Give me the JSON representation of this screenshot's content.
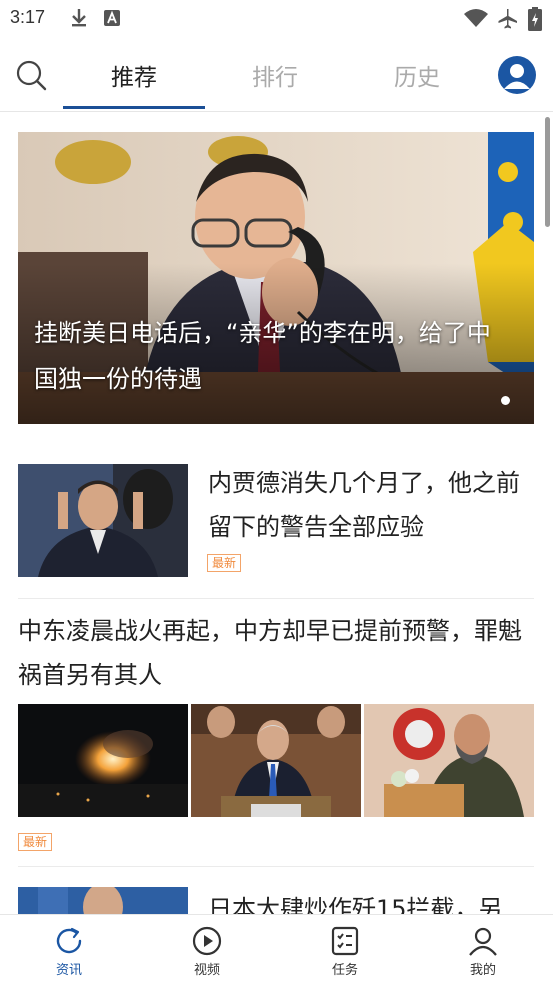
{
  "status_bar": {
    "time": "3:17",
    "icons": [
      "download-icon",
      "text-a-icon",
      "wifi-icon",
      "airplane-mode-icon",
      "battery-charging-icon"
    ]
  },
  "top_bar": {
    "tabs": [
      {
        "label": "推荐",
        "active": true
      },
      {
        "label": "排行",
        "active": false
      },
      {
        "label": "历史",
        "active": false
      }
    ],
    "icons": [
      "search-icon",
      "profile-icon"
    ],
    "accent_color": "#1b4f96"
  },
  "feed": {
    "hero": {
      "title": "挂断美日电话后，“亲华”的李在明，给了中国独一份的待遇",
      "image": "man-on-phone-photo",
      "carousel_position": 1
    },
    "items": [
      {
        "title": "内贾德消失几个月了，他之前留下的警告全部应验",
        "badge": "最新",
        "image": "man-waving-photo"
      },
      {
        "title": "中东凌晨战火再起，中方却早已提前预警，罪魁祸首另有其人",
        "badge": "最新",
        "images": [
          "night-explosion-photo",
          "man-at-podium-photo",
          "military-officer-speaking-photo"
        ]
      },
      {
        "title": "日本大肆炒作歼15拦截，另"
      }
    ],
    "badge_color": "#f08a3c"
  },
  "bottom_nav": {
    "items": [
      {
        "label": "资讯",
        "icon": "refresh-icon",
        "active": true
      },
      {
        "label": "视频",
        "icon": "play-icon",
        "active": false
      },
      {
        "label": "任务",
        "icon": "task-list-icon",
        "active": false
      },
      {
        "label": "我的",
        "icon": "person-icon",
        "active": false
      }
    ],
    "active_color": "#1b56a3"
  }
}
